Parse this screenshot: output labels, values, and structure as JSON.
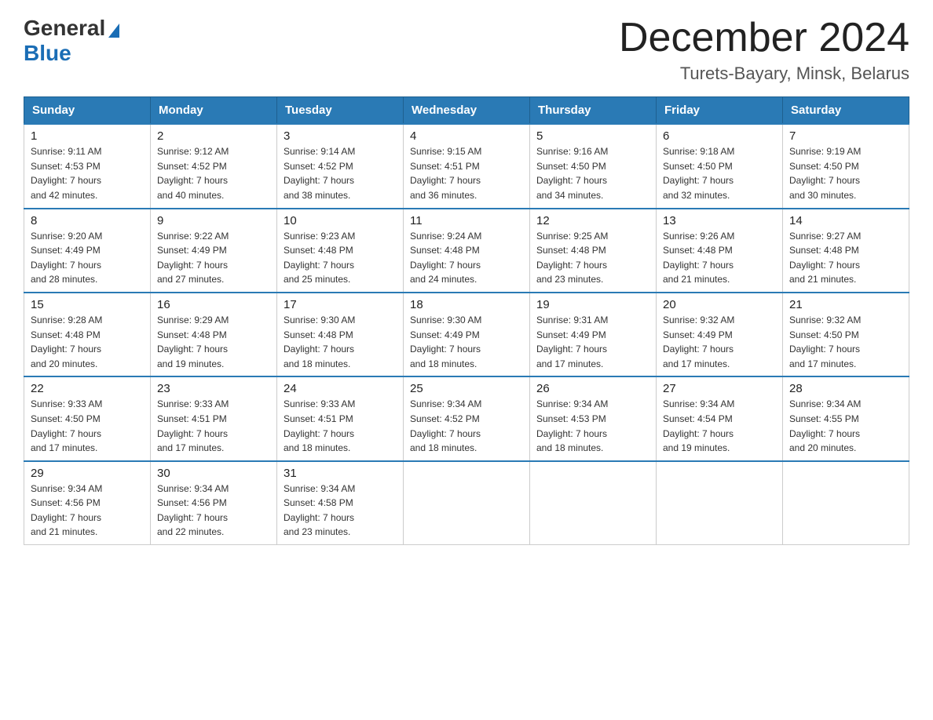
{
  "logo": {
    "general": "General",
    "blue": "Blue"
  },
  "title": {
    "month_year": "December 2024",
    "location": "Turets-Bayary, Minsk, Belarus"
  },
  "weekdays": [
    "Sunday",
    "Monday",
    "Tuesday",
    "Wednesday",
    "Thursday",
    "Friday",
    "Saturday"
  ],
  "weeks": [
    [
      {
        "day": "1",
        "info": "Sunrise: 9:11 AM\nSunset: 4:53 PM\nDaylight: 7 hours\nand 42 minutes."
      },
      {
        "day": "2",
        "info": "Sunrise: 9:12 AM\nSunset: 4:52 PM\nDaylight: 7 hours\nand 40 minutes."
      },
      {
        "day": "3",
        "info": "Sunrise: 9:14 AM\nSunset: 4:52 PM\nDaylight: 7 hours\nand 38 minutes."
      },
      {
        "day": "4",
        "info": "Sunrise: 9:15 AM\nSunset: 4:51 PM\nDaylight: 7 hours\nand 36 minutes."
      },
      {
        "day": "5",
        "info": "Sunrise: 9:16 AM\nSunset: 4:50 PM\nDaylight: 7 hours\nand 34 minutes."
      },
      {
        "day": "6",
        "info": "Sunrise: 9:18 AM\nSunset: 4:50 PM\nDaylight: 7 hours\nand 32 minutes."
      },
      {
        "day": "7",
        "info": "Sunrise: 9:19 AM\nSunset: 4:50 PM\nDaylight: 7 hours\nand 30 minutes."
      }
    ],
    [
      {
        "day": "8",
        "info": "Sunrise: 9:20 AM\nSunset: 4:49 PM\nDaylight: 7 hours\nand 28 minutes."
      },
      {
        "day": "9",
        "info": "Sunrise: 9:22 AM\nSunset: 4:49 PM\nDaylight: 7 hours\nand 27 minutes."
      },
      {
        "day": "10",
        "info": "Sunrise: 9:23 AM\nSunset: 4:48 PM\nDaylight: 7 hours\nand 25 minutes."
      },
      {
        "day": "11",
        "info": "Sunrise: 9:24 AM\nSunset: 4:48 PM\nDaylight: 7 hours\nand 24 minutes."
      },
      {
        "day": "12",
        "info": "Sunrise: 9:25 AM\nSunset: 4:48 PM\nDaylight: 7 hours\nand 23 minutes."
      },
      {
        "day": "13",
        "info": "Sunrise: 9:26 AM\nSunset: 4:48 PM\nDaylight: 7 hours\nand 21 minutes."
      },
      {
        "day": "14",
        "info": "Sunrise: 9:27 AM\nSunset: 4:48 PM\nDaylight: 7 hours\nand 21 minutes."
      }
    ],
    [
      {
        "day": "15",
        "info": "Sunrise: 9:28 AM\nSunset: 4:48 PM\nDaylight: 7 hours\nand 20 minutes."
      },
      {
        "day": "16",
        "info": "Sunrise: 9:29 AM\nSunset: 4:48 PM\nDaylight: 7 hours\nand 19 minutes."
      },
      {
        "day": "17",
        "info": "Sunrise: 9:30 AM\nSunset: 4:48 PM\nDaylight: 7 hours\nand 18 minutes."
      },
      {
        "day": "18",
        "info": "Sunrise: 9:30 AM\nSunset: 4:49 PM\nDaylight: 7 hours\nand 18 minutes."
      },
      {
        "day": "19",
        "info": "Sunrise: 9:31 AM\nSunset: 4:49 PM\nDaylight: 7 hours\nand 17 minutes."
      },
      {
        "day": "20",
        "info": "Sunrise: 9:32 AM\nSunset: 4:49 PM\nDaylight: 7 hours\nand 17 minutes."
      },
      {
        "day": "21",
        "info": "Sunrise: 9:32 AM\nSunset: 4:50 PM\nDaylight: 7 hours\nand 17 minutes."
      }
    ],
    [
      {
        "day": "22",
        "info": "Sunrise: 9:33 AM\nSunset: 4:50 PM\nDaylight: 7 hours\nand 17 minutes."
      },
      {
        "day": "23",
        "info": "Sunrise: 9:33 AM\nSunset: 4:51 PM\nDaylight: 7 hours\nand 17 minutes."
      },
      {
        "day": "24",
        "info": "Sunrise: 9:33 AM\nSunset: 4:51 PM\nDaylight: 7 hours\nand 18 minutes."
      },
      {
        "day": "25",
        "info": "Sunrise: 9:34 AM\nSunset: 4:52 PM\nDaylight: 7 hours\nand 18 minutes."
      },
      {
        "day": "26",
        "info": "Sunrise: 9:34 AM\nSunset: 4:53 PM\nDaylight: 7 hours\nand 18 minutes."
      },
      {
        "day": "27",
        "info": "Sunrise: 9:34 AM\nSunset: 4:54 PM\nDaylight: 7 hours\nand 19 minutes."
      },
      {
        "day": "28",
        "info": "Sunrise: 9:34 AM\nSunset: 4:55 PM\nDaylight: 7 hours\nand 20 minutes."
      }
    ],
    [
      {
        "day": "29",
        "info": "Sunrise: 9:34 AM\nSunset: 4:56 PM\nDaylight: 7 hours\nand 21 minutes."
      },
      {
        "day": "30",
        "info": "Sunrise: 9:34 AM\nSunset: 4:56 PM\nDaylight: 7 hours\nand 22 minutes."
      },
      {
        "day": "31",
        "info": "Sunrise: 9:34 AM\nSunset: 4:58 PM\nDaylight: 7 hours\nand 23 minutes."
      },
      {
        "day": "",
        "info": ""
      },
      {
        "day": "",
        "info": ""
      },
      {
        "day": "",
        "info": ""
      },
      {
        "day": "",
        "info": ""
      }
    ]
  ]
}
